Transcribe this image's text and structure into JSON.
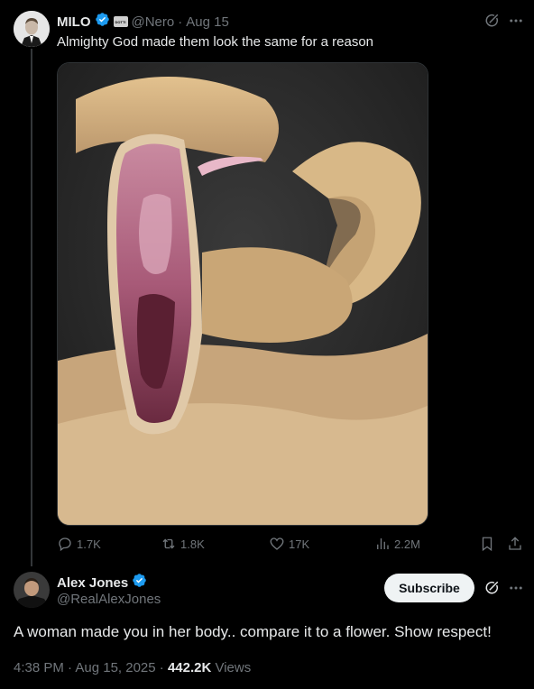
{
  "tweet1": {
    "display_name": "MILO",
    "affiliate_badge": "DOTTI",
    "handle": "@Nero",
    "separator": "·",
    "date": "Aug 15",
    "text": "Almighty God made them look the same for a reason",
    "actions": {
      "replies": "1.7K",
      "reposts": "1.8K",
      "likes": "17K",
      "views": "2.2M"
    }
  },
  "tweet2": {
    "display_name": "Alex Jones",
    "handle": "@RealAlexJones",
    "subscribe_label": "Subscribe",
    "text": "A woman made you in her body.. compare it to a flower. Show respect!",
    "timestamp": "4:38 PM · Aug 15, 2025 · ",
    "views_count": "442.2K",
    "views_label": " Views"
  },
  "colors": {
    "background": "#000000",
    "text": "#e7e9ea",
    "muted": "#71767b",
    "verified": "#1d9bf0",
    "subscribe_bg": "#eff3f4"
  }
}
